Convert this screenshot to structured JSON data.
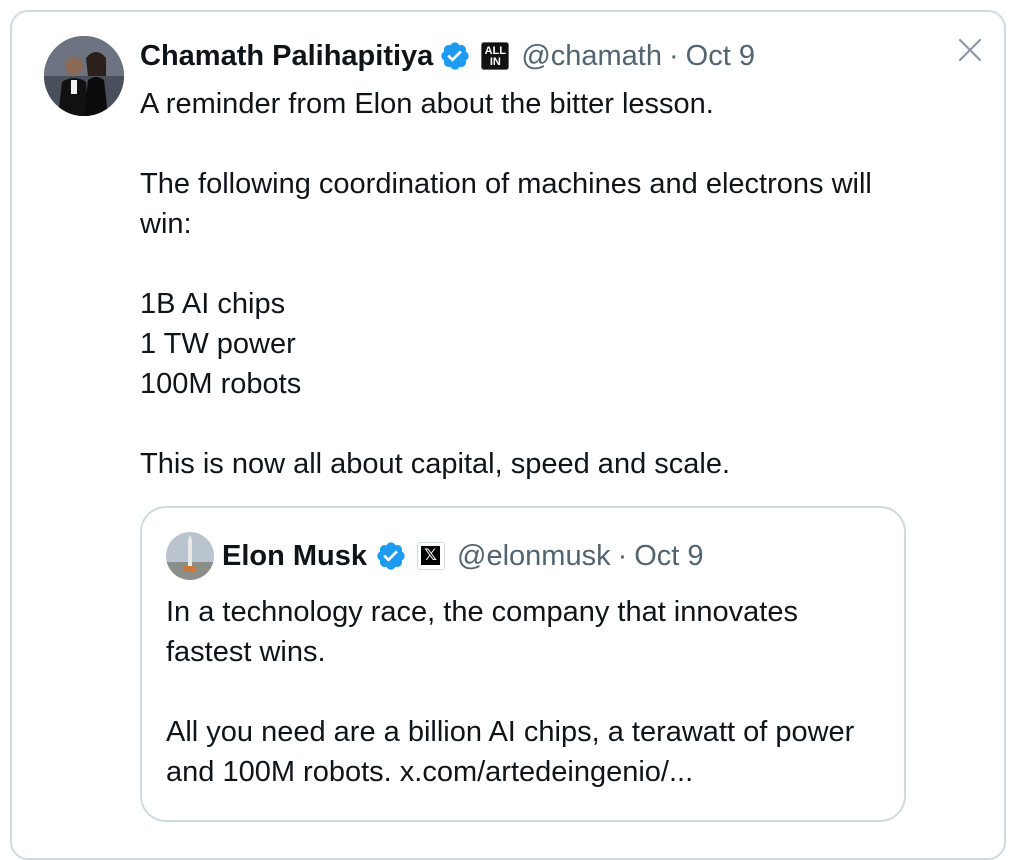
{
  "tweet": {
    "author_name": "Chamath Palihapitiya",
    "verified_icon": "verified-badge-icon",
    "affiliation_badge_text": "ALL IN",
    "handle": "@chamath",
    "separator": "·",
    "date": "Oct 9",
    "body": "A reminder from Elon about the bitter lesson.\n\nThe following coordination of machines and electrons will win:\n\n1B AI chips\n1 TW power\n100M robots\n\nThis is now all about capital, speed and scale."
  },
  "quoted_tweet": {
    "author_name": "Elon Musk",
    "verified_icon": "verified-badge-icon",
    "affiliation_badge_text": "𝕏",
    "handle": "@elonmusk",
    "separator": "·",
    "date": "Oct 9",
    "body": "In a technology race, the company that innovates fastest wins.\n\nAll you need are a billion AI chips, a terawatt of power and 100M robots. ",
    "link_text": "x.com/artedeingenio/..."
  },
  "close_icon": "close-icon",
  "colors": {
    "border": "#cfd9de",
    "secondary_text": "#536471",
    "verified_blue": "#1d9bf0",
    "text": "#0f1419"
  }
}
